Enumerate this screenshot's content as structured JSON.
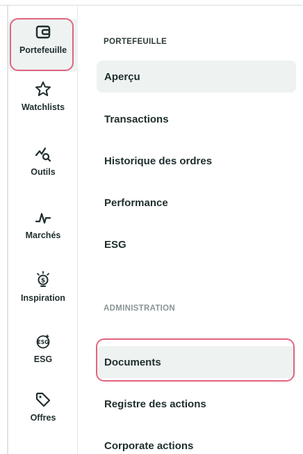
{
  "colors": {
    "accent_outline": "#e2647f",
    "selected_bg": "#eef3f2",
    "text": "#1f2d2d",
    "muted": "#8a9494"
  },
  "rail": {
    "items": [
      {
        "label": "Portefeuille",
        "icon": "wallet-icon"
      },
      {
        "label": "Watchlists",
        "icon": "star-icon"
      },
      {
        "label": "Outils",
        "icon": "chart-search-icon"
      },
      {
        "label": "Marchés",
        "icon": "market-pulse-icon"
      },
      {
        "label": "Inspiration",
        "icon": "lightbulb-dollar-icon"
      },
      {
        "label": "ESG",
        "icon": "esg-icon"
      },
      {
        "label": "Offres",
        "icon": "tag-icon"
      }
    ]
  },
  "menu": {
    "sections": [
      {
        "title": "PORTEFEUILLE",
        "items": [
          "Aperçu",
          "Transactions",
          "Historique des ordres",
          "Performance",
          "ESG"
        ]
      },
      {
        "title": "ADMINISTRATION",
        "items": [
          "Documents",
          "Registre des actions",
          "Corporate actions"
        ]
      }
    ]
  }
}
